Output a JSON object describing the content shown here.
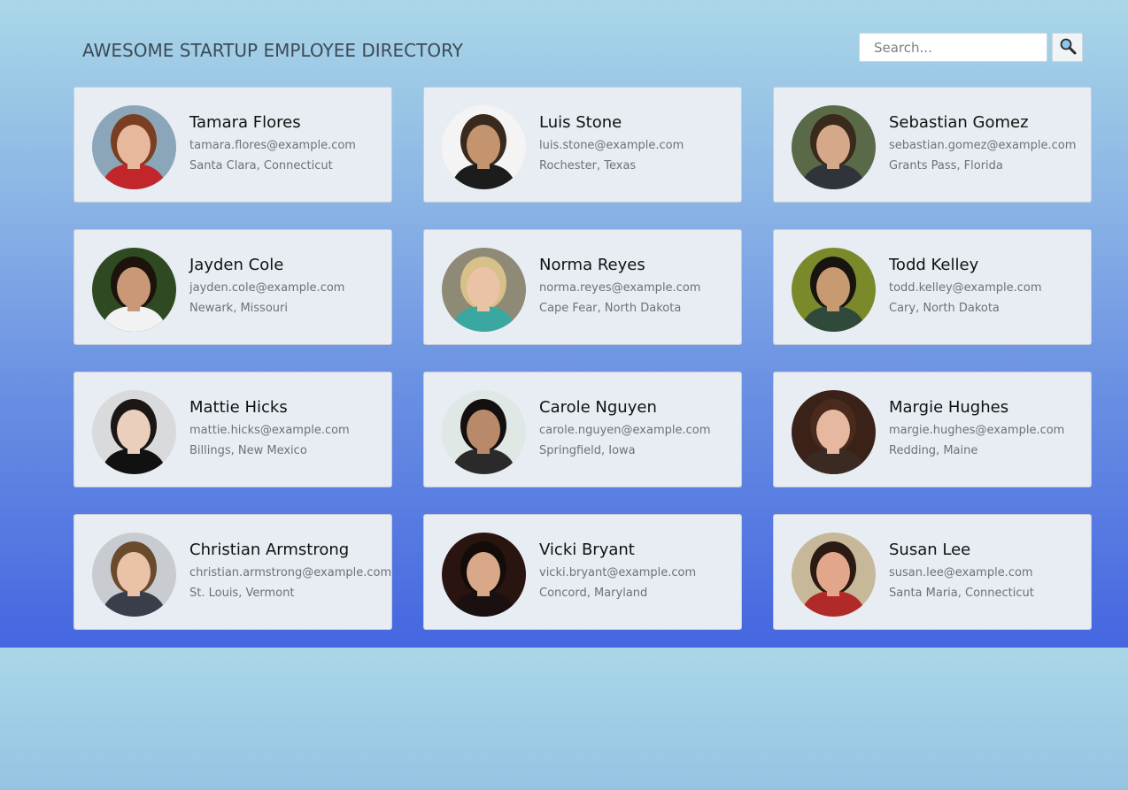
{
  "header": {
    "title": "AWESOME STARTUP EMPLOYEE DIRECTORY"
  },
  "search": {
    "placeholder": "Search...",
    "button_icon": "magnifier-icon"
  },
  "employees": [
    {
      "name": "Tamara Flores",
      "email": "tamara.flores@example.com",
      "location": "Santa Clara, Connecticut",
      "skin": "#e8b89c",
      "hair": "#7a3f22",
      "bg": "#8aa6b8",
      "shirt": "#c0262a"
    },
    {
      "name": "Luis Stone",
      "email": "luis.stone@example.com",
      "location": "Rochester, Texas",
      "skin": "#c4946e",
      "hair": "#3a2a1e",
      "bg": "#f4f4f4",
      "shirt": "#1c1c1c"
    },
    {
      "name": "Sebastian Gomez",
      "email": "sebastian.gomez@example.com",
      "location": "Grants Pass, Florida",
      "skin": "#d6a88a",
      "hair": "#3a2a1c",
      "bg": "#5a6a48",
      "shirt": "#30343a"
    },
    {
      "name": "Jayden Cole",
      "email": "jayden.cole@example.com",
      "location": "Newark, Missouri",
      "skin": "#c99876",
      "hair": "#1c130c",
      "bg": "#2f4a22",
      "shirt": "#f2f2f2"
    },
    {
      "name": "Norma Reyes",
      "email": "norma.reyes@example.com",
      "location": "Cape Fear, North Dakota",
      "skin": "#eac2a6",
      "hair": "#d8c08a",
      "bg": "#8e8a76",
      "shirt": "#3aa8a0"
    },
    {
      "name": "Todd Kelley",
      "email": "todd.kelley@example.com",
      "location": "Cary, North Dakota",
      "skin": "#c89a72",
      "hair": "#1a1410",
      "bg": "#7a8a2a",
      "shirt": "#2f4a3a"
    },
    {
      "name": "Mattie Hicks",
      "email": "mattie.hicks@example.com",
      "location": "Billings, New Mexico",
      "skin": "#ead0bc",
      "hair": "#1c1614",
      "bg": "#d8dadc",
      "shirt": "#111111"
    },
    {
      "name": "Carole Nguyen",
      "email": "carole.nguyen@example.com",
      "location": "Springfield, Iowa",
      "skin": "#b88a6a",
      "hair": "#141010",
      "bg": "#dfe8e4",
      "shirt": "#2a2a2a"
    },
    {
      "name": "Margie Hughes",
      "email": "margie.hughes@example.com",
      "location": "Redding, Maine",
      "skin": "#e6b8a0",
      "hair": "#4a2a1c",
      "bg": "#3a2218",
      "shirt": "#3a2a22"
    },
    {
      "name": "Christian Armstrong",
      "email": "christian.armstrong@example.com",
      "location": "St. Louis, Vermont",
      "skin": "#eac2a8",
      "hair": "#6a4a2c",
      "bg": "#c8ccd0",
      "shirt": "#3a3e4a"
    },
    {
      "name": "Vicki Bryant",
      "email": "vicki.bryant@example.com",
      "location": "Concord, Maryland",
      "skin": "#d8a888",
      "hair": "#140c08",
      "bg": "#2a1410",
      "shirt": "#1a1010"
    },
    {
      "name": "Susan Lee",
      "email": "susan.lee@example.com",
      "location": "Santa Maria, Connecticut",
      "skin": "#e2a68a",
      "hair": "#2a1a12",
      "bg": "#c8b89a",
      "shirt": "#b02a2a"
    }
  ]
}
